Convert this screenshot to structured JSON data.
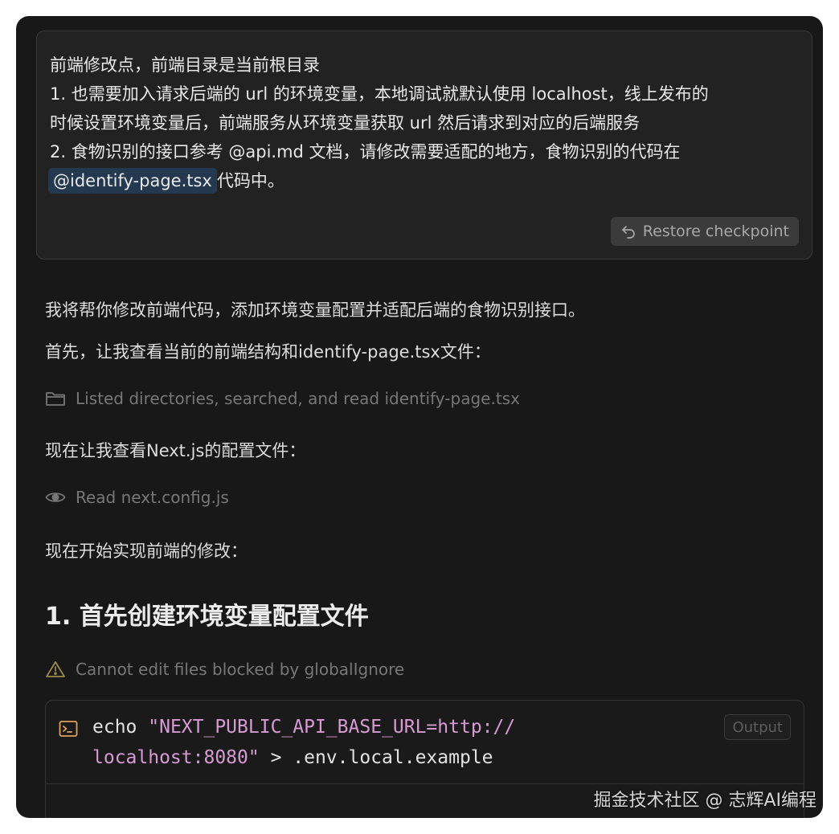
{
  "user_message": {
    "lines": [
      "前端修改点，前端目录是当前根目录",
      "1. 也需要加入请求后端的 url 的环境变量，本地调试就默认使用 localhost，线上发布的",
      "时候设置环境变量后，前端服务从环境变量获取 url 然后请求到对应的后端服务",
      "2. 食物识别的接口参考 @api.md 文档，请修改需要适配的地方，食物识别的代码在"
    ],
    "mention": "@identify-page.tsx",
    "after_mention": "代码中。",
    "restore_label": "Restore checkpoint"
  },
  "assistant": {
    "intro": "我将帮你修改前端代码，添加环境变量配置并适配后端的食物识别接口。",
    "first_step": "首先，让我查看当前的前端结构和identify-page.tsx文件：",
    "tool1": "Listed directories, searched, and read identify-page.tsx",
    "step2": "现在让我查看Next.js的配置文件：",
    "tool2": "Read next.config.js",
    "step3": "现在开始实现前端的修改：",
    "heading": "1. 首先创建环境变量配置文件",
    "warning": "Cannot edit files blocked by globalIgnore"
  },
  "terminal": {
    "cmd": "echo ",
    "str1": "\"NEXT_PUBLIC_API_BASE_URL=http://",
    "str2": "localhost:8080\"",
    "rest": " > .env.local.example",
    "output_label": "Output"
  },
  "watermark": "掘金技术社区 @ 志辉AI编程",
  "colors": {
    "background": "#181818",
    "mention_bg": "#24394f",
    "string": "#d79ad4",
    "terminal_icon": "#e0a15a",
    "warning_icon": "#9a8a4a"
  },
  "icons": [
    "restore-icon",
    "folder-icon",
    "eye-icon",
    "warning-icon",
    "terminal-icon"
  ]
}
